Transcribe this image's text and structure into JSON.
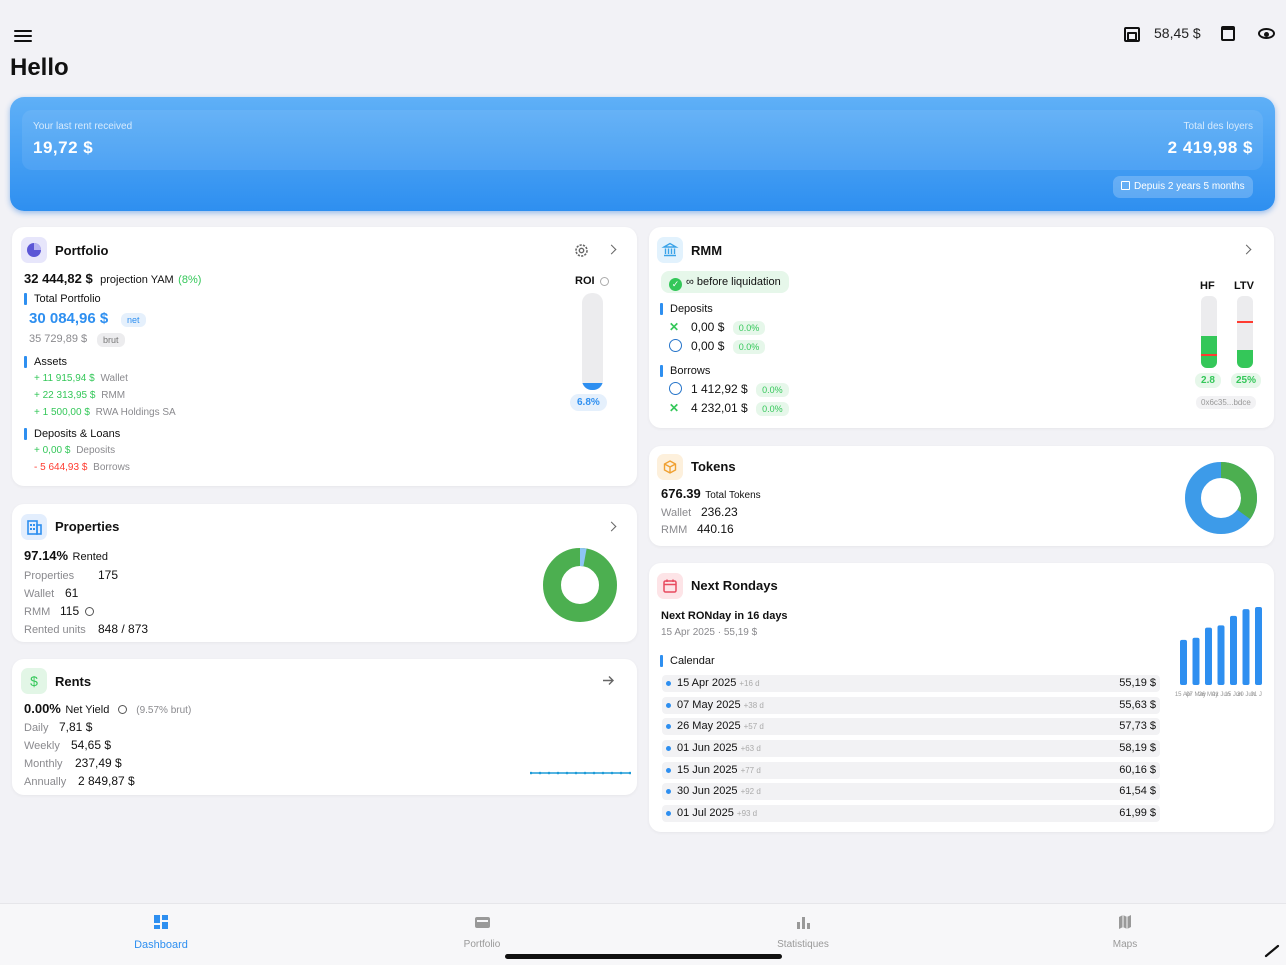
{
  "header": {
    "balance": "58,45 $",
    "greeting": "Hello"
  },
  "banner": {
    "last_rent_label": "Your last rent received",
    "last_rent_value": "19,72 $",
    "total_label": "Total des loyers",
    "total_value": "2 419,98 $",
    "since": "Depuis 2 years 5 months"
  },
  "portfolio": {
    "title": "Portfolio",
    "value": "32 444,82 $",
    "projection": "projection YAM",
    "projection_pct": "(8%)",
    "total_label": "Total Portfolio",
    "net_value": "30 084,96 $",
    "net_tag": "net",
    "brut_value": "35 729,89 $",
    "brut_tag": "brut",
    "assets_label": "Assets",
    "assets": [
      {
        "amount": "+ 11 915,94 $",
        "label": "Wallet"
      },
      {
        "amount": "+ 22 313,95 $",
        "label": "RMM"
      },
      {
        "amount": "+ 1 500,00 $",
        "label": "RWA Holdings SA"
      }
    ],
    "dl_label": "Deposits & Loans",
    "deposits": {
      "amount": "+ 0,00 $",
      "label": "Deposits"
    },
    "borrows": {
      "amount": "- 5 644,93 $",
      "label": "Borrows"
    },
    "roi_label": "ROI",
    "roi_value": "6.8%",
    "roi_fraction": 0.068
  },
  "properties": {
    "title": "Properties",
    "rented_pct": "97.14%",
    "rented_label": "Rented",
    "rented_fraction": 0.9714,
    "rows": [
      {
        "label": "Properties",
        "value": "175"
      },
      {
        "label": "Wallet",
        "value": "61"
      },
      {
        "label": "RMM",
        "value": "115"
      },
      {
        "label": "Rented units",
        "value": "848 / 873"
      }
    ]
  },
  "rents": {
    "title": "Rents",
    "yield": "0.00%",
    "yield_label": "Net Yield",
    "brut": "(9.57% brut)",
    "rows": [
      {
        "label": "Daily",
        "value": "7,81 $"
      },
      {
        "label": "Weekly",
        "value": "54,65 $"
      },
      {
        "label": "Monthly",
        "value": "237,49 $"
      },
      {
        "label": "Annually",
        "value": "2 849,87 $"
      }
    ]
  },
  "rmm": {
    "title": "RMM",
    "badge": "∞ before liquidation",
    "deposits_label": "Deposits",
    "deposits": [
      {
        "amount": "0,00 $",
        "pct": "0.0%",
        "icon": "xdai-icon"
      },
      {
        "amount": "0,00 $",
        "pct": "0.0%",
        "icon": "usdc-icon"
      }
    ],
    "borrows_label": "Borrows",
    "borrows": [
      {
        "amount": "1 412,92 $",
        "pct": "0.0%",
        "icon": "usdc-icon"
      },
      {
        "amount": "4 232,01 $",
        "pct": "0.0%",
        "icon": "xdai-icon"
      }
    ],
    "hf_label": "HF",
    "hf_value": "2.8",
    "hf_fraction": 0.45,
    "ltv_label": "LTV",
    "ltv_value": "25%",
    "ltv_fraction": 0.25,
    "address": "0x6c35...bdce"
  },
  "tokens": {
    "title": "Tokens",
    "total": "676.39",
    "total_label": "Total Tokens",
    "wallet_label": "Wallet",
    "wallet_value": "236.23",
    "rmm_label": "RMM",
    "rmm_value": "440.16",
    "wallet_fraction": 0.349
  },
  "rondays": {
    "title": "Next Rondays",
    "next": "Next RONday in 16 days",
    "sub": "15 Apr 2025 · 55,19 $",
    "calendar_label": "Calendar",
    "items": [
      {
        "date": "15 Apr 2025",
        "rel": "+16 d",
        "amount": "55,19 $"
      },
      {
        "date": "07 May 2025",
        "rel": "+38 d",
        "amount": "55,63 $"
      },
      {
        "date": "26 May 2025",
        "rel": "+57 d",
        "amount": "57,73 $"
      },
      {
        "date": "01 Jun 2025",
        "rel": "+63 d",
        "amount": "58,19 $"
      },
      {
        "date": "15 Jun 2025",
        "rel": "+77 d",
        "amount": "60,16 $"
      },
      {
        "date": "30 Jun 2025",
        "rel": "+92 d",
        "amount": "61,54 $"
      },
      {
        "date": "01 Jul 2025",
        "rel": "+93 d",
        "amount": "61,99 $"
      }
    ],
    "chart_ticks": [
      "15 Apr",
      "07 May",
      "26 May",
      "01 Jun",
      "15 Jun",
      "30 Jun",
      "01 Jul"
    ]
  },
  "tabs": [
    {
      "label": "Dashboard",
      "icon": "dashboard-icon",
      "active": true
    },
    {
      "label": "Portfolio",
      "icon": "wallet-icon",
      "active": false
    },
    {
      "label": "Statistiques",
      "icon": "bar-chart-icon",
      "active": false
    },
    {
      "label": "Maps",
      "icon": "map-icon",
      "active": false
    }
  ],
  "colors": {
    "accent": "#2e8ff0",
    "positive": "#34c759",
    "negative": "#ff3b30"
  }
}
